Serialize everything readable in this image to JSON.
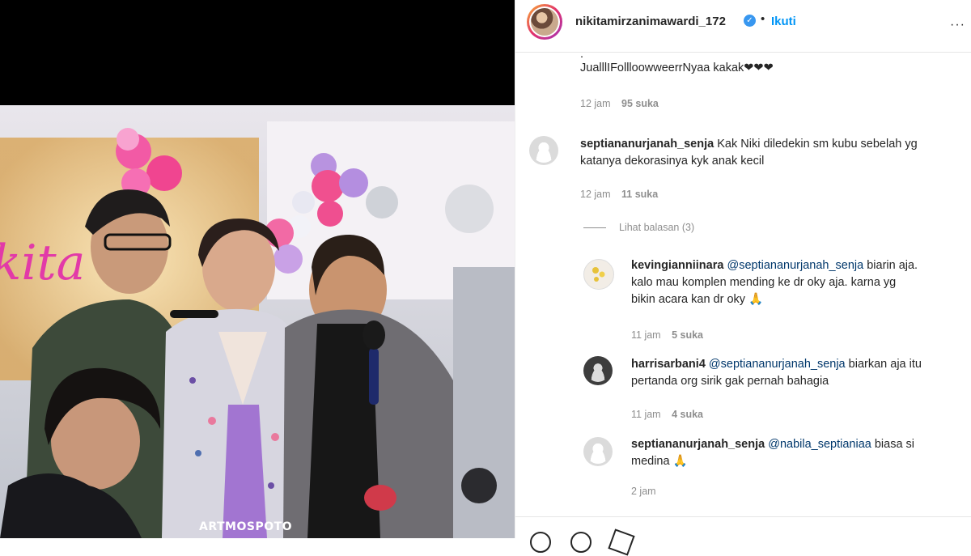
{
  "header": {
    "username": "nikitamirzanimawardi_172",
    "separator": "•",
    "follow_label": "Ikuti",
    "more_icon": "more-icon"
  },
  "photo": {
    "watermark": "ARTMOSPOTO"
  },
  "comments": [
    {
      "text_top": ".",
      "text": "JualllIFollloowweerrNyaa kakak❤❤❤",
      "time": "12 jam",
      "likes": "95 suka"
    },
    {
      "user": "septiananurjanah_senja",
      "text_line1": "Kak Niki diledekin sm kubu sebelah yg",
      "text_line2": "katanya dekorasinya kyk anak kecil",
      "time": "12 jam",
      "likes": "11 suka"
    }
  ],
  "view_replies": "Lihat balasan (3)",
  "replies": [
    {
      "user": "kevingianniinara",
      "mention": "@septiananurjanah_senja",
      "text_line1": "biarin aja.",
      "text_line2": "kalo mau komplen mending ke dr oky aja. karna yg",
      "text_line3": "bikin acara kan dr oky 🙏",
      "time": "11 jam",
      "likes": "5 suka"
    },
    {
      "user": "harrisarbani4",
      "mention": "@septiananurjanah_senja",
      "text_line1": "biarkan aja itu",
      "text_line2": "pertanda org sirik gak pernah bahagia",
      "time": "11 jam",
      "likes": "4 suka"
    },
    {
      "user": "septiananurjanah_senja",
      "mention": "@nabila_septianiaa",
      "text_line1": "biasa si",
      "text_line2": "medina 🙏",
      "time": "2 jam"
    }
  ],
  "colors": {
    "link_blue": "#0095f6",
    "mention_blue": "#00376b",
    "meta_grey": "#8e8e8e"
  }
}
